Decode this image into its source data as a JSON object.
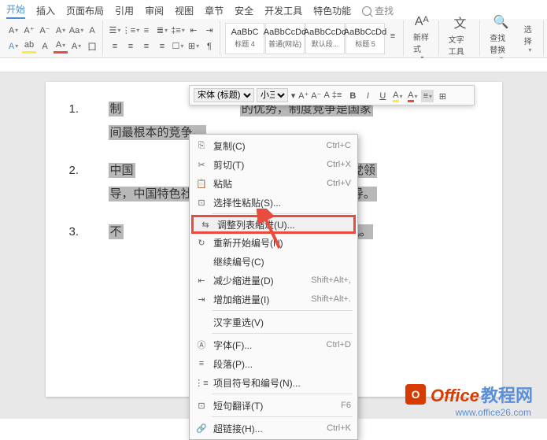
{
  "tabs": [
    "开始",
    "插入",
    "页面布局",
    "引用",
    "审阅",
    "视图",
    "章节",
    "安全",
    "开发工具",
    "特色功能"
  ],
  "active_tab": 0,
  "search_placeholder": "查找",
  "styles": [
    {
      "preview": "AaBbC",
      "name": "标题 4"
    },
    {
      "preview": "AaBbCcDd",
      "name": "普通(网站)"
    },
    {
      "preview": "AaBbCcDd",
      "name": "默认段..."
    },
    {
      "preview": "AaBbCcDd",
      "name": "标题 5"
    }
  ],
  "toolbar_right": {
    "new_style": "新样式",
    "text_tools": "文字工具",
    "find_replace": "查找替换",
    "select": "选择"
  },
  "doc": {
    "items": [
      {
        "num": "1.",
        "line1": "制",
        "line1_tail": "的优势，制度竞争是国家",
        "line2": "间最根本的竞争。"
      },
      {
        "num": "2.",
        "line1_head": "中国",
        "line1_tail": "是中国共产党领",
        "line2_head": "导，中国特色社",
        "line2_tail": "共产党领导。"
      },
      {
        "num": "3.",
        "line1_head": "不",
        "line1_tail": "方控化危为机。"
      }
    ]
  },
  "mini": {
    "font": "宋体 (标题)",
    "size": "小三",
    "btns": [
      "A⁺",
      "A⁻",
      "A"
    ]
  },
  "menu": [
    {
      "type": "item",
      "icon": "copy",
      "label": "复制(C)",
      "shortcut": "Ctrl+C"
    },
    {
      "type": "item",
      "icon": "cut",
      "label": "剪切(T)",
      "shortcut": "Ctrl+X"
    },
    {
      "type": "item",
      "icon": "paste",
      "label": "粘贴",
      "shortcut": "Ctrl+V"
    },
    {
      "type": "item",
      "icon": "paste-special",
      "label": "选择性粘贴(S)...",
      "shortcut": ""
    },
    {
      "type": "sep"
    },
    {
      "type": "item",
      "icon": "adjust",
      "label": "调整列表缩进(U)...",
      "shortcut": "",
      "highlighted": true
    },
    {
      "type": "item",
      "icon": "restart",
      "label": "重新开始编号(N)",
      "shortcut": ""
    },
    {
      "type": "item",
      "icon": "continue",
      "label": "继续编号(C)",
      "shortcut": ""
    },
    {
      "type": "item",
      "icon": "dec-indent",
      "label": "减少缩进量(D)",
      "shortcut": "Shift+Alt+,"
    },
    {
      "type": "item",
      "icon": "inc-indent",
      "label": "增加缩进量(I)",
      "shortcut": "Shift+Alt+."
    },
    {
      "type": "sep"
    },
    {
      "type": "item",
      "icon": "reselect",
      "label": "汉字重选(V)",
      "shortcut": ""
    },
    {
      "type": "sep"
    },
    {
      "type": "item",
      "icon": "font",
      "label": "字体(F)...",
      "shortcut": "Ctrl+D"
    },
    {
      "type": "item",
      "icon": "para",
      "label": "段落(P)...",
      "shortcut": ""
    },
    {
      "type": "item",
      "icon": "bullets",
      "label": "项目符号和编号(N)...",
      "shortcut": ""
    },
    {
      "type": "sep"
    },
    {
      "type": "item",
      "icon": "translate",
      "label": "短句翻译(T)",
      "shortcut": "F6"
    },
    {
      "type": "sep"
    },
    {
      "type": "item",
      "icon": "link",
      "label": "超链接(H)...",
      "shortcut": "Ctrl+K"
    }
  ],
  "watermark": {
    "brand": "Office",
    "cn": "教程网",
    "url": "www.office26.com"
  }
}
